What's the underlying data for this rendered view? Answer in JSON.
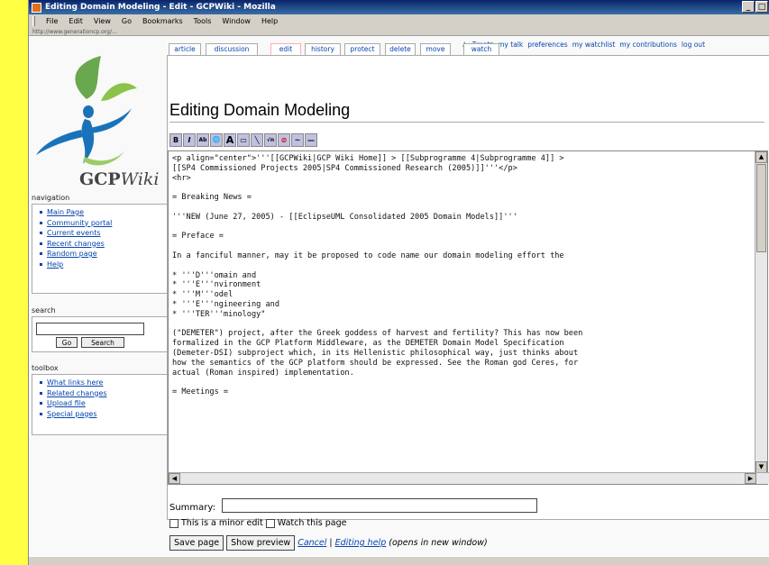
{
  "window": {
    "title": "Editing Domain Modeling - Edit - GCPWiki - Mozilla",
    "controls": [
      "_",
      "□"
    ]
  },
  "menu": [
    "File",
    "Edit",
    "View",
    "Go",
    "Bookmarks",
    "Tools",
    "Window",
    "Help"
  ],
  "status_line": "http://www.generationcp.org/...",
  "logo": {
    "name": "GCP",
    "suffix": "Wiki"
  },
  "sidebar": {
    "navigation_title": "navigation",
    "navigation": [
      "Main Page",
      "Community portal",
      "Current events",
      "Recent changes",
      "Random page",
      "Help"
    ],
    "search_title": "search",
    "search_go": "Go",
    "search_search": "Search",
    "toolbox_title": "toolbox",
    "toolbox": [
      "What links here",
      "Related changes",
      "Upload file",
      "Special pages"
    ]
  },
  "personal_tools": [
    "Tmetz",
    "my talk",
    "preferences",
    "my watchlist",
    "my contributions",
    "log out"
  ],
  "tabs": [
    "article",
    "discussion",
    "edit",
    "history",
    "protect",
    "delete",
    "move",
    "watch"
  ],
  "page_title": "Editing Domain Modeling",
  "toolbar": [
    "B",
    "I",
    "Ab",
    "🌐",
    "A",
    "▭",
    "╲",
    "√n",
    "⊘",
    "~",
    "—"
  ],
  "edit_text": "<p align=\"center\">'''[[GCPWiki|GCP Wiki Home]] > [[Subprogramme 4|Subprogramme 4]] >\n[[SP4 Commissioned Projects 2005|SP4 Commissioned Research (2005)]]'''</p>\n<hr>\n\n= Breaking News =\n\n'''NEW (June 27, 2005) - [[EclipseUML Consolidated 2005 Domain Models]]'''\n\n= Preface =\n\nIn a fanciful manner, may it be proposed to code name our domain modeling effort the\n\n* '''D'''omain and\n* '''E'''nvironment\n* '''M'''odel\n* '''E'''ngineering and\n* '''TER'''minology\"\n\n(\"DEMETER\") project, after the Greek goddess of harvest and fertility? This has now been\nformalized in the GCP Platform Middleware, as the DEMETER Domain Model Specification\n(Demeter-DSI) subproject which, in its Hellenistic philosophical way, just thinks about\nhow the semantics of the GCP platform should be expressed. See the Roman god Ceres, for\nactual (Roman inspired) implementation.\n\n= Meetings =",
  "summary_label": "Summary:",
  "minor_edit": "This is a minor edit",
  "watch_page": "Watch this page",
  "save_button": "Save page",
  "preview_button": "Show preview",
  "cancel_link": "Cancel",
  "separator": "|",
  "help_link": "Editing help",
  "help_note": "(opens in new window)"
}
